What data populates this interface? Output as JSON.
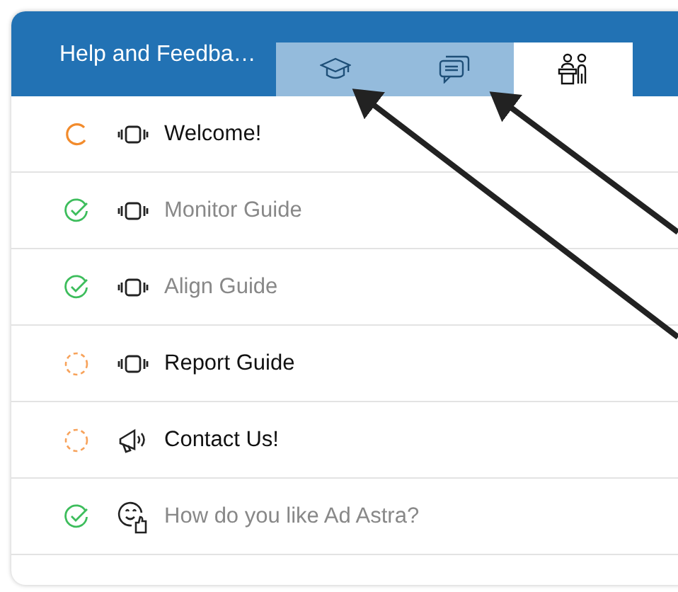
{
  "panel": {
    "title": "Help and Feedba…"
  },
  "tabs": [
    {
      "kind": "graduation",
      "selected": false
    },
    {
      "kind": "chat",
      "selected": false
    },
    {
      "kind": "presenter",
      "selected": true
    }
  ],
  "items": [
    {
      "label": "Welcome!",
      "started": true,
      "completed": false,
      "kind": "device"
    },
    {
      "label": "Monitor Guide",
      "started": true,
      "completed": true,
      "kind": "device"
    },
    {
      "label": "Align Guide",
      "started": true,
      "completed": true,
      "kind": "device"
    },
    {
      "label": "Report Guide",
      "started": false,
      "completed": false,
      "kind": "device"
    },
    {
      "label": "Contact Us!",
      "started": false,
      "completed": false,
      "kind": "megaphone"
    },
    {
      "label": "How do you like Ad Astra?",
      "started": true,
      "completed": true,
      "kind": "feedback"
    }
  ]
}
